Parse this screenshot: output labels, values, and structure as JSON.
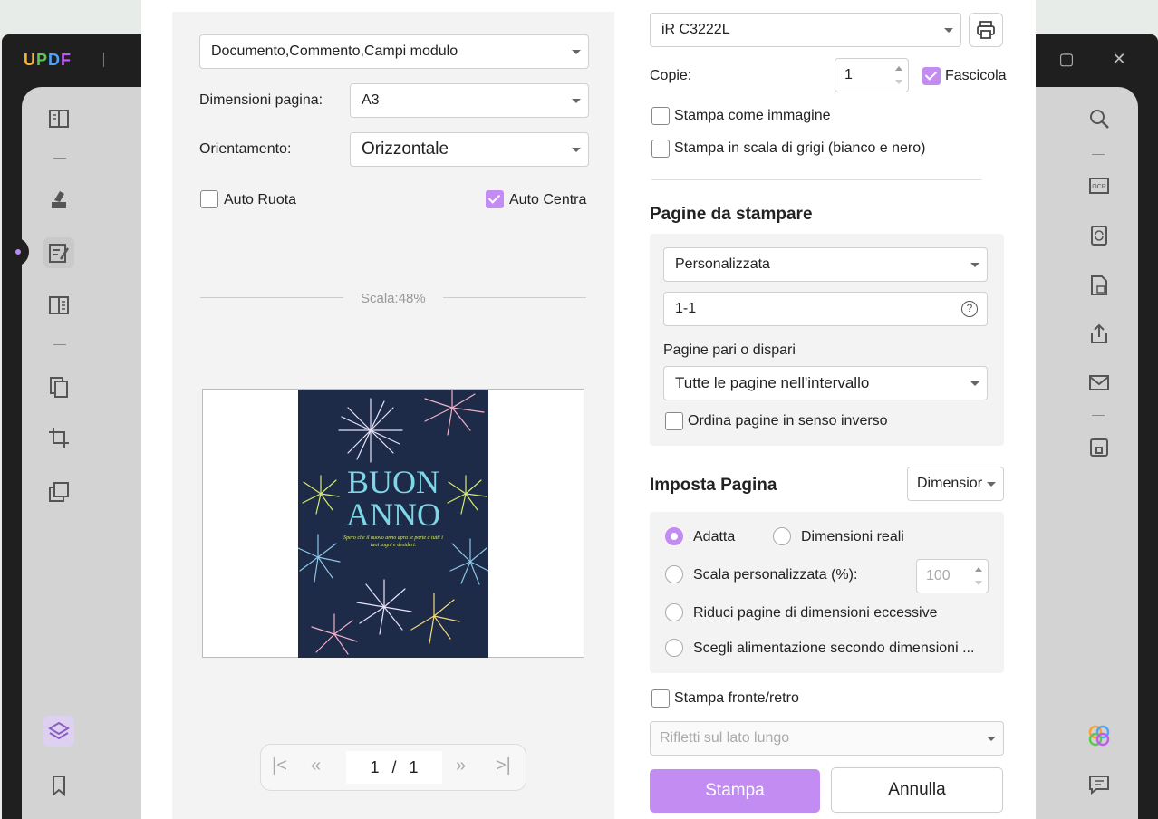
{
  "app": {
    "logo": [
      "U",
      "P",
      "D",
      "F"
    ]
  },
  "print_dialog": {
    "content_select": "Documento,Commento,Campi modulo",
    "page_size_label": "Dimensioni pagina:",
    "page_size_value": "A3",
    "orientation_label": "Orientamento:",
    "orientation_value": "Orizzontale",
    "auto_rotate_label": "Auto Ruota",
    "auto_center_label": "Auto Centra",
    "scale_label": "Scala:48%",
    "preview": {
      "title_line1": "BUON",
      "title_line2": "ANNO",
      "subtitle": "Spero che il nuovo anno apra le porte a tutti i tuoi sogni e desideri."
    },
    "pager": {
      "current": "1",
      "separator": "/",
      "total": "1"
    },
    "printer_value": "iR C3222L",
    "copies_label": "Copie:",
    "copies_value": "1",
    "collate_label": "Fascicola",
    "print_as_image_label": "Stampa come immagine",
    "grayscale_label": "Stampa in scala di grigi (bianco e nero)",
    "pages_header": "Pagine da stampare",
    "range_mode": "Personalizzata",
    "range_value": "1-1",
    "odd_even_label": "Pagine pari o dispari",
    "odd_even_value": "Tutte le pagine nell'intervallo",
    "reverse_label": "Ordina pagine in senso inverso",
    "page_setup_header": "Imposta Pagina",
    "page_setup_select": "Dimensior",
    "fit_label": "Adatta",
    "actual_size_label": "Dimensioni reali",
    "custom_scale_label": "Scala personalizzata (%):",
    "custom_scale_value": "100",
    "shrink_label": "Riduci pagine di dimensioni eccessive",
    "paper_source_label": "Scegli alimentazione secondo dimensioni ...",
    "duplex_label": "Stampa fronte/retro",
    "duplex_value": "Rifletti sul lato lungo",
    "print_button": "Stampa",
    "cancel_button": "Annulla"
  },
  "colors": {
    "accent": "#c28cf2",
    "print_button": "#c28cf2"
  }
}
